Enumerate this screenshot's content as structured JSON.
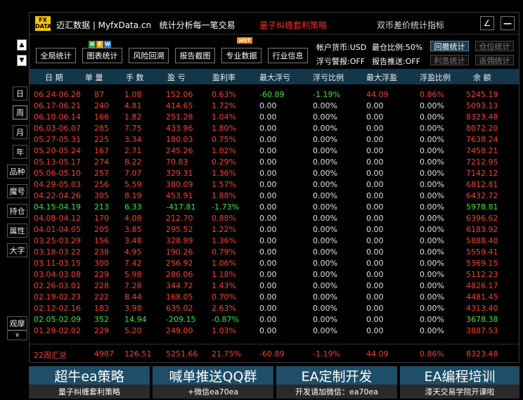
{
  "header": {
    "logo_text": "FX DATA",
    "brand": "迈汇数据 | MyfxData.cn",
    "slogan": "统计分析每一笔交易",
    "strategy_name": "量子纠缠套利策略",
    "indicator_title": "双币差价统计指标",
    "edit_icon": "∠",
    "minimize_icon": "—"
  },
  "toolbar": {
    "buttons": [
      "全局统计",
      "图表统计",
      "风险回溯",
      "报告截图",
      "专业数据",
      "行业信息"
    ],
    "new_badge": [
      "N",
      "E",
      "W"
    ],
    "hot_badge": "HOT"
  },
  "account": {
    "currency": "帐户货币:USD",
    "max_ratio": "最仓比例:50%",
    "float_warn": "浮亏警报:OFF",
    "report_push": "报告推送:OFF",
    "buttons": {
      "drawdown": "回撤统计",
      "position": "仓位统计",
      "interest": "利息统计",
      "rebate": "返佣统计"
    }
  },
  "sidebar": {
    "periods": [
      "日",
      "周",
      "月",
      "年"
    ],
    "active_period": "周",
    "menu": [
      "品种",
      "魔号",
      "持仓",
      "属性",
      "大字"
    ],
    "bottom": "观摩",
    "up_arrow": "▲",
    "down_arrow": "▼",
    "small_down": "∨"
  },
  "table": {
    "columns": [
      "日 期",
      "单 量",
      "手 数",
      "盈 亏",
      "盈利率",
      "最大浮亏",
      "浮亏比例",
      "最大浮盈",
      "浮盈比例",
      "余 额"
    ],
    "rows": [
      {
        "date": "06.24-06.28",
        "orders": "87",
        "lots": "1.08",
        "profit": "152.06",
        "rate": "0.63%",
        "max_dd": "-60.89",
        "dd_ratio": "-1.19%",
        "max_fp": "44.09",
        "fp_ratio": "0.86%",
        "balance": "5245.19",
        "color": "red",
        "dd_color": "green"
      },
      {
        "date": "06.17-06.21",
        "orders": "240",
        "lots": "4.81",
        "profit": "414.65",
        "rate": "1.72%",
        "max_dd": "0.00",
        "dd_ratio": "0.00%",
        "max_fp": "0.00",
        "fp_ratio": "0.00%",
        "balance": "5093.13",
        "color": "red"
      },
      {
        "date": "06.10-06.14",
        "orders": "166",
        "lots": "1.82",
        "profit": "251.28",
        "rate": "1.04%",
        "max_dd": "0.00",
        "dd_ratio": "0.00%",
        "max_fp": "0.00",
        "fp_ratio": "0.00%",
        "balance": "8323.48",
        "color": "red"
      },
      {
        "date": "06.03-06.07",
        "orders": "285",
        "lots": "7.75",
        "profit": "433.96",
        "rate": "1.80%",
        "max_dd": "0.00",
        "dd_ratio": "0.00%",
        "max_fp": "0.00",
        "fp_ratio": "0.00%",
        "balance": "8072.20",
        "color": "red"
      },
      {
        "date": "05.27-05.31",
        "orders": "225",
        "lots": "3.34",
        "profit": "180.03",
        "rate": "0.75%",
        "max_dd": "0.00",
        "dd_ratio": "0.00%",
        "max_fp": "0.00",
        "fp_ratio": "0.00%",
        "balance": "7638.24",
        "color": "red"
      },
      {
        "date": "05.20-05.24",
        "orders": "167",
        "lots": "2.71",
        "profit": "245.26",
        "rate": "1.02%",
        "max_dd": "0.00",
        "dd_ratio": "0.00%",
        "max_fp": "0.00",
        "fp_ratio": "0.00%",
        "balance": "7458.21",
        "color": "red"
      },
      {
        "date": "05.13-05.17",
        "orders": "274",
        "lots": "8.22",
        "profit": "70.83",
        "rate": "0.29%",
        "max_dd": "0.00",
        "dd_ratio": "0.00%",
        "max_fp": "0.00",
        "fp_ratio": "0.00%",
        "balance": "7212.95",
        "color": "red"
      },
      {
        "date": "05.06-05.10",
        "orders": "257",
        "lots": "7.07",
        "profit": "329.31",
        "rate": "1.36%",
        "max_dd": "0.00",
        "dd_ratio": "0.00%",
        "max_fp": "0.00",
        "fp_ratio": "0.00%",
        "balance": "7142.12",
        "color": "red"
      },
      {
        "date": "04.29-05.03",
        "orders": "256",
        "lots": "5.59",
        "profit": "380.09",
        "rate": "1.57%",
        "max_dd": "0.00",
        "dd_ratio": "0.00%",
        "max_fp": "0.00",
        "fp_ratio": "0.00%",
        "balance": "6812.81",
        "color": "red"
      },
      {
        "date": "04.22-04.26",
        "orders": "305",
        "lots": "8.19",
        "profit": "453.91",
        "rate": "1.88%",
        "max_dd": "0.00",
        "dd_ratio": "0.00%",
        "max_fp": "0.00",
        "fp_ratio": "0.00%",
        "balance": "6432.72",
        "color": "red"
      },
      {
        "date": "04.15-04.19",
        "orders": "213",
        "lots": "6.33",
        "profit": "-417.81",
        "rate": "-1.73%",
        "max_dd": "0.00",
        "dd_ratio": "0.00%",
        "max_fp": "0.00",
        "fp_ratio": "0.00%",
        "balance": "5978.81",
        "color": "green"
      },
      {
        "date": "04.08-04.12",
        "orders": "170",
        "lots": "4.08",
        "profit": "212.70",
        "rate": "0.88%",
        "max_dd": "0.00",
        "dd_ratio": "0.00%",
        "max_fp": "0.00",
        "fp_ratio": "0.00%",
        "balance": "6396.62",
        "color": "red"
      },
      {
        "date": "04.01-04.05",
        "orders": "205",
        "lots": "3.85",
        "profit": "295.52",
        "rate": "1.22%",
        "max_dd": "0.00",
        "dd_ratio": "0.00%",
        "max_fp": "0.00",
        "fp_ratio": "0.00%",
        "balance": "6183.92",
        "color": "red"
      },
      {
        "date": "03.25-03.29",
        "orders": "156",
        "lots": "3.48",
        "profit": "328.99",
        "rate": "1.36%",
        "max_dd": "0.00",
        "dd_ratio": "0.00%",
        "max_fp": "0.00",
        "fp_ratio": "0.00%",
        "balance": "5888.40",
        "color": "red"
      },
      {
        "date": "03.18-03.22",
        "orders": "238",
        "lots": "4.95",
        "profit": "190.26",
        "rate": "0.79%",
        "max_dd": "0.00",
        "dd_ratio": "0.00%",
        "max_fp": "0.00",
        "fp_ratio": "0.00%",
        "balance": "5559.41",
        "color": "red"
      },
      {
        "date": "03.11-03.15",
        "orders": "300",
        "lots": "7.42",
        "profit": "256.92",
        "rate": "1.06%",
        "max_dd": "0.00",
        "dd_ratio": "0.00%",
        "max_fp": "0.00",
        "fp_ratio": "0.00%",
        "balance": "5369.15",
        "color": "red"
      },
      {
        "date": "03.04-03.08",
        "orders": "229",
        "lots": "5.98",
        "profit": "286.06",
        "rate": "1.18%",
        "max_dd": "0.00",
        "dd_ratio": "0.00%",
        "max_fp": "0.00",
        "fp_ratio": "0.00%",
        "balance": "5112.23",
        "color": "red"
      },
      {
        "date": "02.26-03.01",
        "orders": "228",
        "lots": "7.28",
        "profit": "344.72",
        "rate": "1.43%",
        "max_dd": "0.00",
        "dd_ratio": "0.00%",
        "max_fp": "0.00",
        "fp_ratio": "0.00%",
        "balance": "4826.17",
        "color": "red"
      },
      {
        "date": "02.19-02.23",
        "orders": "222",
        "lots": "8.44",
        "profit": "168.05",
        "rate": "0.70%",
        "max_dd": "0.00",
        "dd_ratio": "0.00%",
        "max_fp": "0.00",
        "fp_ratio": "0.00%",
        "balance": "4481.45",
        "color": "red"
      },
      {
        "date": "02.12-02.16",
        "orders": "183",
        "lots": "3.98",
        "profit": "635.02",
        "rate": "2.63%",
        "max_dd": "0.00",
        "dd_ratio": "0.00%",
        "max_fp": "0.00",
        "fp_ratio": "0.00%",
        "balance": "4313.40",
        "color": "red"
      },
      {
        "date": "02.05-02.09",
        "orders": "352",
        "lots": "14.94",
        "profit": "-209.15",
        "rate": "-0.87%",
        "max_dd": "0.00",
        "dd_ratio": "0.00%",
        "max_fp": "0.00",
        "fp_ratio": "0.00%",
        "balance": "3678.38",
        "color": "green"
      },
      {
        "date": "01.29-02.02",
        "orders": "229",
        "lots": "5.20",
        "profit": "249.00",
        "rate": "1.03%",
        "max_dd": "0.00",
        "dd_ratio": "0.00%",
        "max_fp": "0.00",
        "fp_ratio": "0.00%",
        "balance": "3887.53",
        "color": "red"
      }
    ],
    "summary": {
      "date": "22周汇总",
      "orders": "4987",
      "lots": "126.51",
      "profit": "5251.66",
      "rate": "21.75%",
      "max_dd": "-60.89",
      "dd_ratio": "-1.19%",
      "max_fp": "44.09",
      "fp_ratio": "0.86%",
      "balance": "8323.48"
    }
  },
  "ads": [
    {
      "title": "超牛ea策略",
      "subtitle": "量子纠缠套利策略"
    },
    {
      "title": "喊单推送QQ群",
      "subtitle": "+微信ea70ea"
    },
    {
      "title": "EA定制开发",
      "subtitle": "开发请加微信：ea70ea"
    },
    {
      "title": "EA编程培训",
      "subtitle": "漆天交易学院开课啦"
    }
  ],
  "colors": {
    "profit": "#ff3b30",
    "loss": "#36e636",
    "neutral": "#e0e0e0",
    "header_bg": "#13374a",
    "ad_bg": "#1e4e68",
    "logo": "#f5c400"
  }
}
